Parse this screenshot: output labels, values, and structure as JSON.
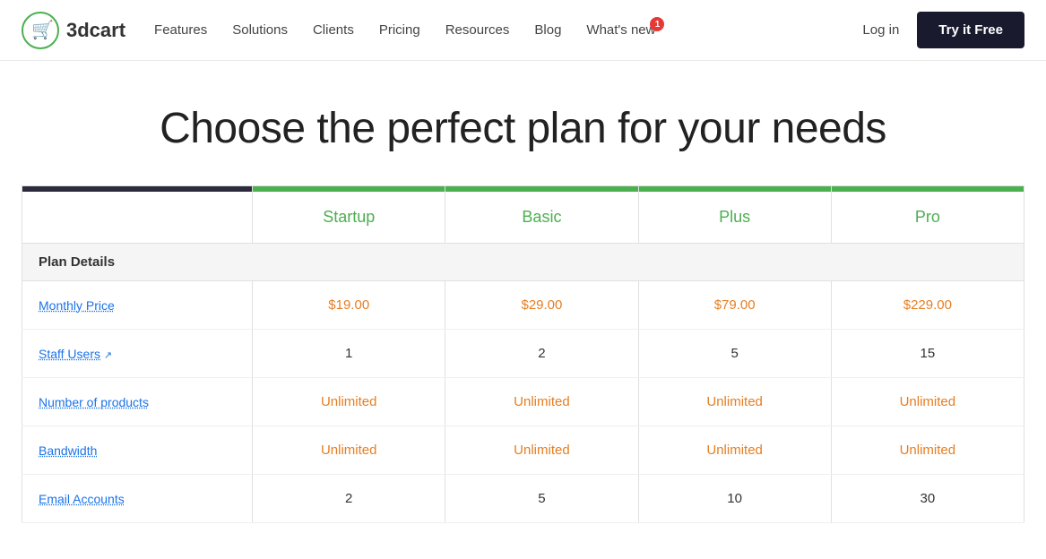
{
  "header": {
    "logo_text": "3dcart",
    "nav_items": [
      "Features",
      "Solutions",
      "Clients",
      "Pricing",
      "Resources",
      "Blog"
    ],
    "whats_new_label": "What's new",
    "notification_count": "1",
    "login_label": "Log in",
    "try_free_label": "Try it Free"
  },
  "hero": {
    "title": "Choose the perfect plan for your needs"
  },
  "pricing": {
    "section_header": "Plan Details",
    "plans": [
      "Startup",
      "Basic",
      "Plus",
      "Pro"
    ],
    "rows": [
      {
        "label": "Monthly Price",
        "type": "price",
        "values": [
          "$19.00",
          "$29.00",
          "$79.00",
          "$229.00"
        ]
      },
      {
        "label": "Staff Users",
        "type": "link",
        "values": [
          "1",
          "2",
          "5",
          "15"
        ]
      },
      {
        "label": "Number of products",
        "type": "link",
        "values": [
          "Unlimited",
          "Unlimited",
          "Unlimited",
          "Unlimited"
        ]
      },
      {
        "label": "Bandwidth",
        "type": "link",
        "values": [
          "Unlimited",
          "Unlimited",
          "Unlimited",
          "Unlimited"
        ]
      },
      {
        "label": "Email Accounts",
        "type": "link",
        "values": [
          "2",
          "5",
          "10",
          "30"
        ]
      }
    ]
  },
  "colors": {
    "green": "#4caf50",
    "dark": "#2b2b3b",
    "orange": "#e67e22",
    "blue": "#1a73e8",
    "price_color": "#e67e22"
  }
}
